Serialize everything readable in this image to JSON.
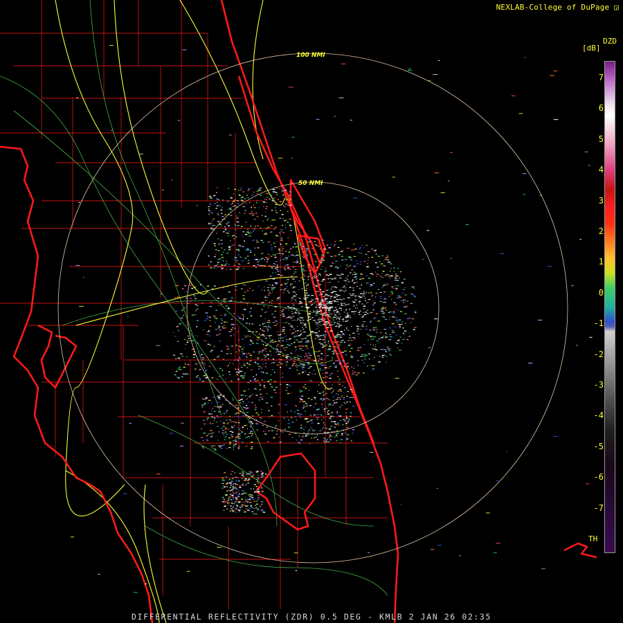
{
  "header": {
    "credit": "NEXLAB-College of DuPage"
  },
  "footer": {
    "product_line": "DIFFERENTIAL REFLECTIVITY (ZDR) 0.5 DEG - KMLB 2 JAN 26 02:35"
  },
  "range_rings": [
    {
      "label": "50 NMI"
    },
    {
      "label": "100 NMI"
    }
  ],
  "colorbar": {
    "product_code": "DZD",
    "unit": "[dB]",
    "ticks": [
      "7",
      "6",
      "5",
      "4",
      "3",
      "2",
      "1",
      "0",
      "-1",
      "-2",
      "-3",
      "-4",
      "-5",
      "-6",
      "-7"
    ],
    "threshold_label": "TH",
    "range_db": [
      -7.5,
      7.5
    ]
  },
  "colors": {
    "coastline": "#ff1a1a",
    "county_lines": "#c81414",
    "highways": "#ffff33",
    "roads": "#55d055",
    "range_rings": "#e8c8a8",
    "labels": "#ffff33"
  }
}
